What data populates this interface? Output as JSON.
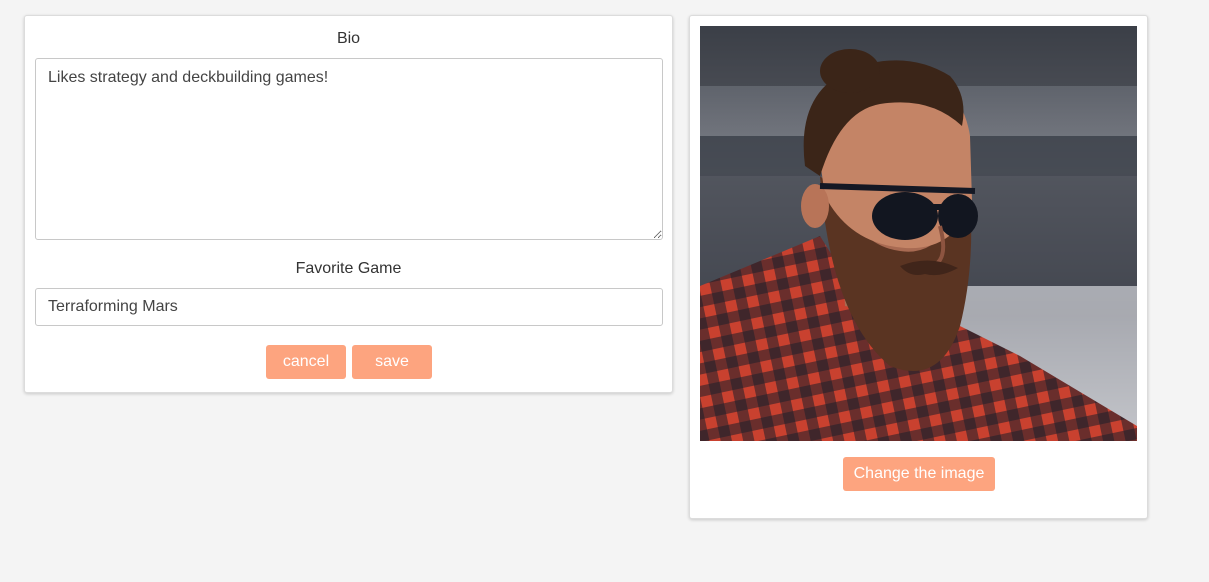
{
  "form": {
    "bio_label": "Bio",
    "bio_value": "Likes strategy and deckbuilding games!",
    "favorite_game_label": "Favorite Game",
    "favorite_game_value": "Terraforming Mars",
    "cancel_label": "cancel",
    "save_label": "save"
  },
  "image_panel": {
    "change_image_label": "Change the image"
  },
  "colors": {
    "accent": "#fda47f",
    "background": "#f4f4f4",
    "card": "#ffffff"
  }
}
